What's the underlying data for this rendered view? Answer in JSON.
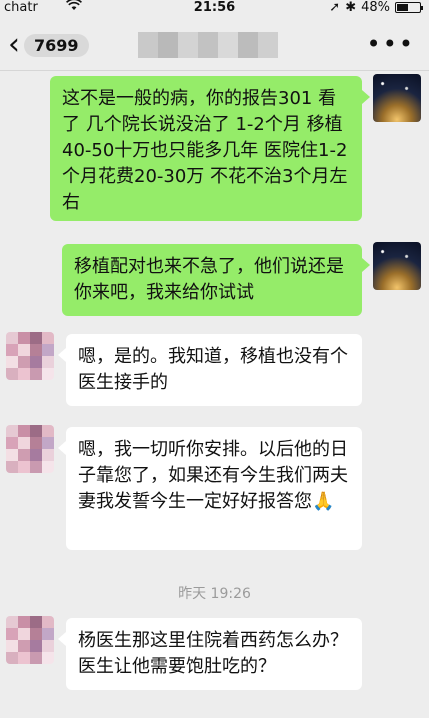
{
  "status_bar": {
    "carrier": "chatr",
    "time": "21:56",
    "battery": "48%",
    "battery_level": 0.48
  },
  "nav": {
    "back_count": "7699",
    "more_glyph": "•••"
  },
  "messages": [
    {
      "side": "self",
      "text": "这不是一般的病，你的报告301 看了 几个院长说没治了 1-2个月 移植40-50十万也只能多几年 医院住1-2个月花费20-30万 不花不治3个月左右"
    },
    {
      "side": "self",
      "text": "移植配对也来不急了，他们说还是你来吧，我来给你试试"
    },
    {
      "side": "peer",
      "text": "嗯，是的。我知道，移植也没有个医生接手的"
    },
    {
      "side": "peer",
      "text": "嗯，我一切听你安排。以后他的日子靠您了，如果还有今生我们两夫妻我发誓今生一定好好报答您",
      "emoji": "🙏"
    },
    {
      "side": "peer",
      "text": "杨医生那这里住院着西药怎么办？医生让他需要饱肚吃的？"
    }
  ],
  "timestamp": "昨天 19:26"
}
